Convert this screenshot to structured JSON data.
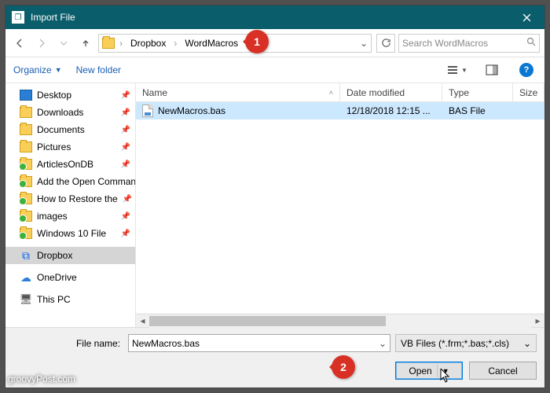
{
  "titlebar": {
    "icon_glyph": "❐",
    "title": "Import File"
  },
  "nav": {
    "crumbs": [
      "Dropbox",
      "WordMacros"
    ],
    "search_placeholder": "Search WordMacros"
  },
  "toolbar": {
    "organize": "Organize",
    "newfolder": "New folder"
  },
  "tree": [
    {
      "label": "Desktop",
      "icon": "desktop",
      "pinned": true
    },
    {
      "label": "Downloads",
      "icon": "folder",
      "pinned": true
    },
    {
      "label": "Documents",
      "icon": "folder",
      "pinned": true
    },
    {
      "label": "Pictures",
      "icon": "folder",
      "pinned": true
    },
    {
      "label": "ArticlesOnDB",
      "icon": "folder-green",
      "pinned": true
    },
    {
      "label": "Add the Open Command",
      "icon": "folder-green",
      "pinned": true
    },
    {
      "label": "How to Restore the",
      "icon": "folder-green",
      "pinned": true
    },
    {
      "label": "images",
      "icon": "folder-green",
      "pinned": true
    },
    {
      "label": "Windows 10 File",
      "icon": "folder-green",
      "pinned": true
    },
    {
      "label": "Dropbox",
      "icon": "dropbox",
      "selected": true,
      "group_before": true
    },
    {
      "label": "OneDrive",
      "icon": "onedrive",
      "group_before": true
    },
    {
      "label": "This PC",
      "icon": "pc",
      "group_before": true
    }
  ],
  "columns": {
    "name": "Name",
    "date": "Date modified",
    "type": "Type",
    "size": "Size"
  },
  "rows": [
    {
      "name": "NewMacros.bas",
      "date": "12/18/2018 12:15 ...",
      "type": "BAS File",
      "selected": true
    }
  ],
  "bottom": {
    "filename_label": "File name:",
    "filename_value": "NewMacros.bas",
    "filter": "VB Files (*.frm;*.bas;*.cls)",
    "open": "Open",
    "cancel": "Cancel"
  },
  "callouts": {
    "one": "1",
    "two": "2"
  },
  "watermark": "groovyPost.com"
}
